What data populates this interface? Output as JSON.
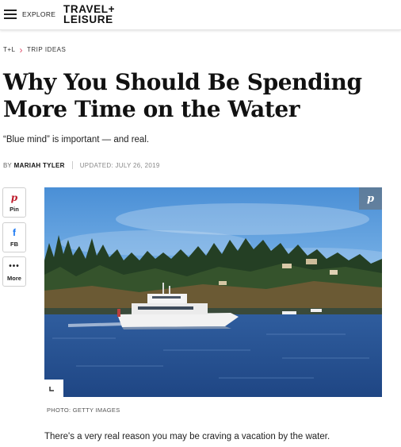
{
  "header": {
    "menu_icon": "hamburger-menu-icon",
    "explore_label": "EXPLORE",
    "logo_line1": "TRAVEL+",
    "logo_line2": "LEISURE"
  },
  "breadcrumb": {
    "items": [
      "T+L",
      "TRIP IDEAS"
    ],
    "separator_icon": "chevron-right-icon"
  },
  "article": {
    "title": "Why You Should Be Spending More Time on the Water",
    "subtitle": "“Blue mind” is important — and real.",
    "byline_prefix": "BY",
    "author": "MARIAH TYLER",
    "updated": "UPDATED: JULY 26, 2019",
    "photo_credit": "PHOTO: GETTY IMAGES",
    "first_paragraph": "There's a very real reason you may be craving a vacation by the water."
  },
  "share": {
    "pinterest_label": "Pin",
    "facebook_label": "FB",
    "more_label": "More",
    "pinterest_icon": "pinterest-icon",
    "facebook_icon": "facebook-icon",
    "more_icon": "ellipsis-icon"
  },
  "image": {
    "overlay_icon": "pinterest-icon",
    "expand_icon": "expand-icon"
  },
  "colors": {
    "breadcrumb_separator": "#e0506e",
    "pinterest": "#bd1a2a",
    "facebook": "#1877f2"
  }
}
